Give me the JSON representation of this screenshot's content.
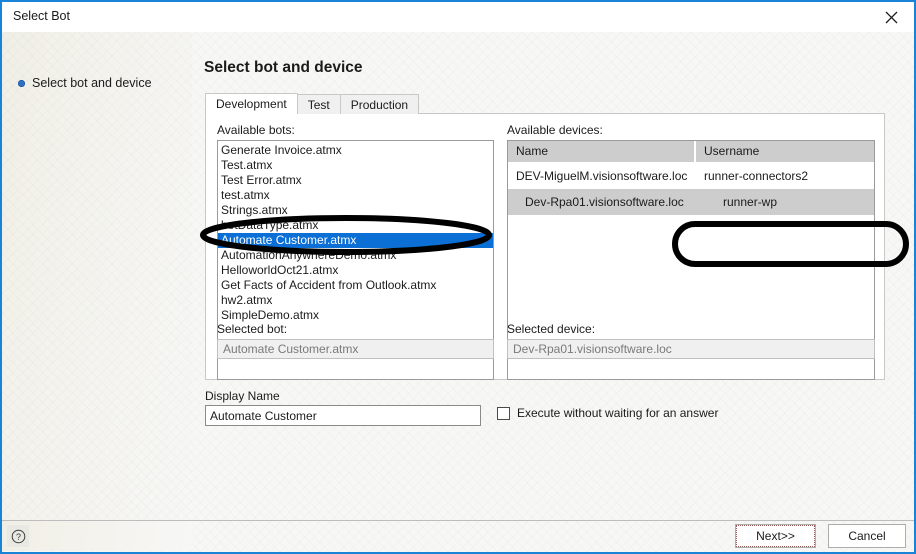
{
  "window": {
    "title": "Select Bot",
    "close_icon": "close-icon"
  },
  "sidebar": {
    "steps": [
      {
        "label": "Select bot and device",
        "bullet_color": "#2d6fc4"
      }
    ]
  },
  "main": {
    "page_title": "Select bot and device",
    "tabs": [
      {
        "label": "Development",
        "active": true
      },
      {
        "label": "Test",
        "active": false
      },
      {
        "label": "Production",
        "active": false
      }
    ],
    "bots": {
      "label": "Available bots:",
      "items": [
        {
          "name": "Generate Invoice.atmx",
          "selected": false
        },
        {
          "name": "Test.atmx",
          "selected": false
        },
        {
          "name": "Test Error.atmx",
          "selected": false
        },
        {
          "name": "test.atmx",
          "selected": false
        },
        {
          "name": "Strings.atmx",
          "selected": false
        },
        {
          "name": "botDataType.atmx",
          "selected": false
        },
        {
          "name": "Automate Customer.atmx",
          "selected": true
        },
        {
          "name": "AutomationAnywhereDemo.atmx",
          "selected": false
        },
        {
          "name": "HelloworldOct21.atmx",
          "selected": false
        },
        {
          "name": "Get Facts of Accident from Outlook.atmx",
          "selected": false
        },
        {
          "name": "hw2.atmx",
          "selected": false
        },
        {
          "name": "SimpleDemo.atmx",
          "selected": false
        }
      ],
      "selection_color": "#0b6fd6"
    },
    "devices": {
      "label": "Available devices:",
      "columns": [
        "Name",
        "Username"
      ],
      "rows": [
        {
          "name": "DEV-MiguelM.visionsoftware.loc",
          "username": "runner-connectors2",
          "selected": false
        },
        {
          "name": "Dev-Rpa01.visionsoftware.loc",
          "username": "runner-wp",
          "selected": true
        }
      ],
      "selection_color": "#cdcdcd"
    },
    "selected_bot": {
      "label": "Selected bot:",
      "value": "Automate Customer.atmx"
    },
    "selected_device": {
      "label": "Selected device:",
      "value": "Dev-Rpa01.visionsoftware.loc"
    },
    "display_name": {
      "label": "Display Name",
      "value": "Automate Customer"
    },
    "execute_without_waiting": {
      "label": "Execute without waiting for an answer",
      "checked": false
    }
  },
  "footer": {
    "help_icon": "help-icon",
    "next_label": "Next>>",
    "cancel_label": "Cancel"
  },
  "annotations": {
    "highlight_color": "#000000",
    "shapes": [
      {
        "target": "selected-bot-row",
        "type": "ellipse"
      },
      {
        "target": "selected-device-row",
        "type": "ellipse"
      }
    ]
  }
}
